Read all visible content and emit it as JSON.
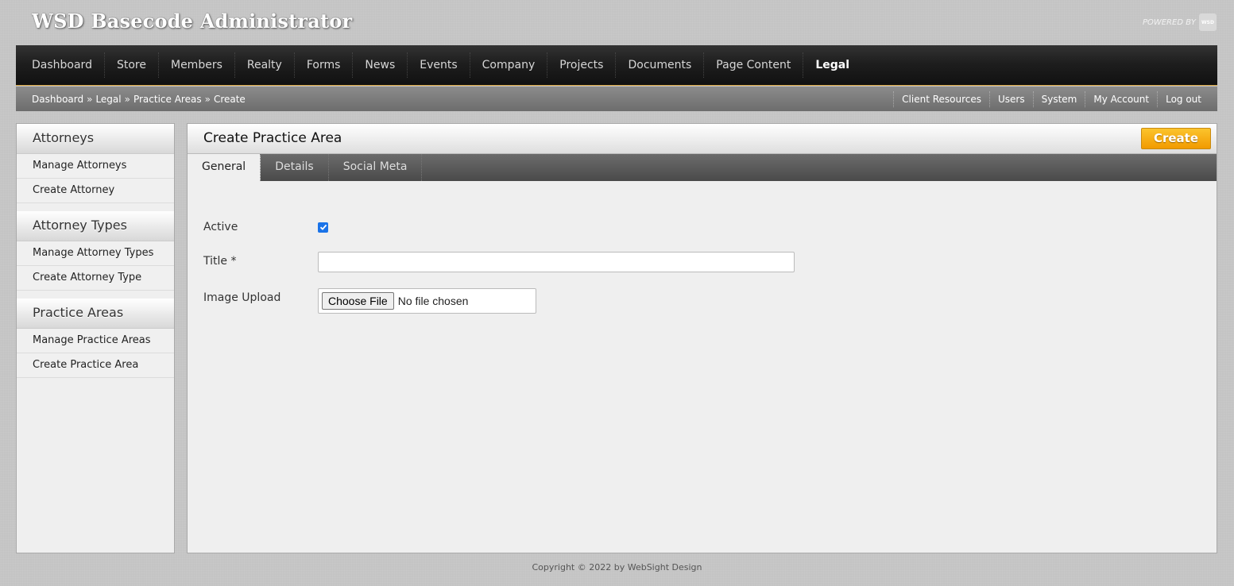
{
  "app": {
    "title": "WSD Basecode Administrator",
    "powered_by": "POWERED BY",
    "logo_text": "WSD"
  },
  "nav": {
    "items": [
      {
        "label": "Dashboard"
      },
      {
        "label": "Store"
      },
      {
        "label": "Members"
      },
      {
        "label": "Realty"
      },
      {
        "label": "Forms"
      },
      {
        "label": "News"
      },
      {
        "label": "Events"
      },
      {
        "label": "Company"
      },
      {
        "label": "Projects"
      },
      {
        "label": "Documents"
      },
      {
        "label": "Page Content"
      },
      {
        "label": "Legal"
      }
    ],
    "active": "Legal"
  },
  "breadcrumb": {
    "items": [
      "Dashboard",
      "Legal",
      "Practice Areas",
      "Create"
    ],
    "separator": "»"
  },
  "utility_links": [
    "Client Resources",
    "Users",
    "System",
    "My Account",
    "Log out"
  ],
  "sidebar": {
    "sections": [
      {
        "title": "Attorneys",
        "links": [
          "Manage Attorneys",
          "Create Attorney"
        ]
      },
      {
        "title": "Attorney Types",
        "links": [
          "Manage Attorney Types",
          "Create Attorney Type"
        ]
      },
      {
        "title": "Practice Areas",
        "links": [
          "Manage Practice Areas",
          "Create Practice Area"
        ]
      }
    ]
  },
  "main": {
    "title": "Create Practice Area",
    "create_label": "Create",
    "tabs": [
      {
        "label": "General"
      },
      {
        "label": "Details"
      },
      {
        "label": "Social Meta"
      }
    ],
    "active_tab": "General",
    "form": {
      "active_label": "Active",
      "active_checked": true,
      "title_label": "Title *",
      "title_value": "",
      "image_label": "Image Upload",
      "file_button": "Choose File",
      "file_status": "No file chosen"
    }
  },
  "footer": {
    "copyright": "Copyright © 2022 by WebSight Design"
  },
  "colors": {
    "accent": "#f29a00",
    "nav_bg": "#1e1e1e",
    "checkbox": "#1a73e8"
  }
}
